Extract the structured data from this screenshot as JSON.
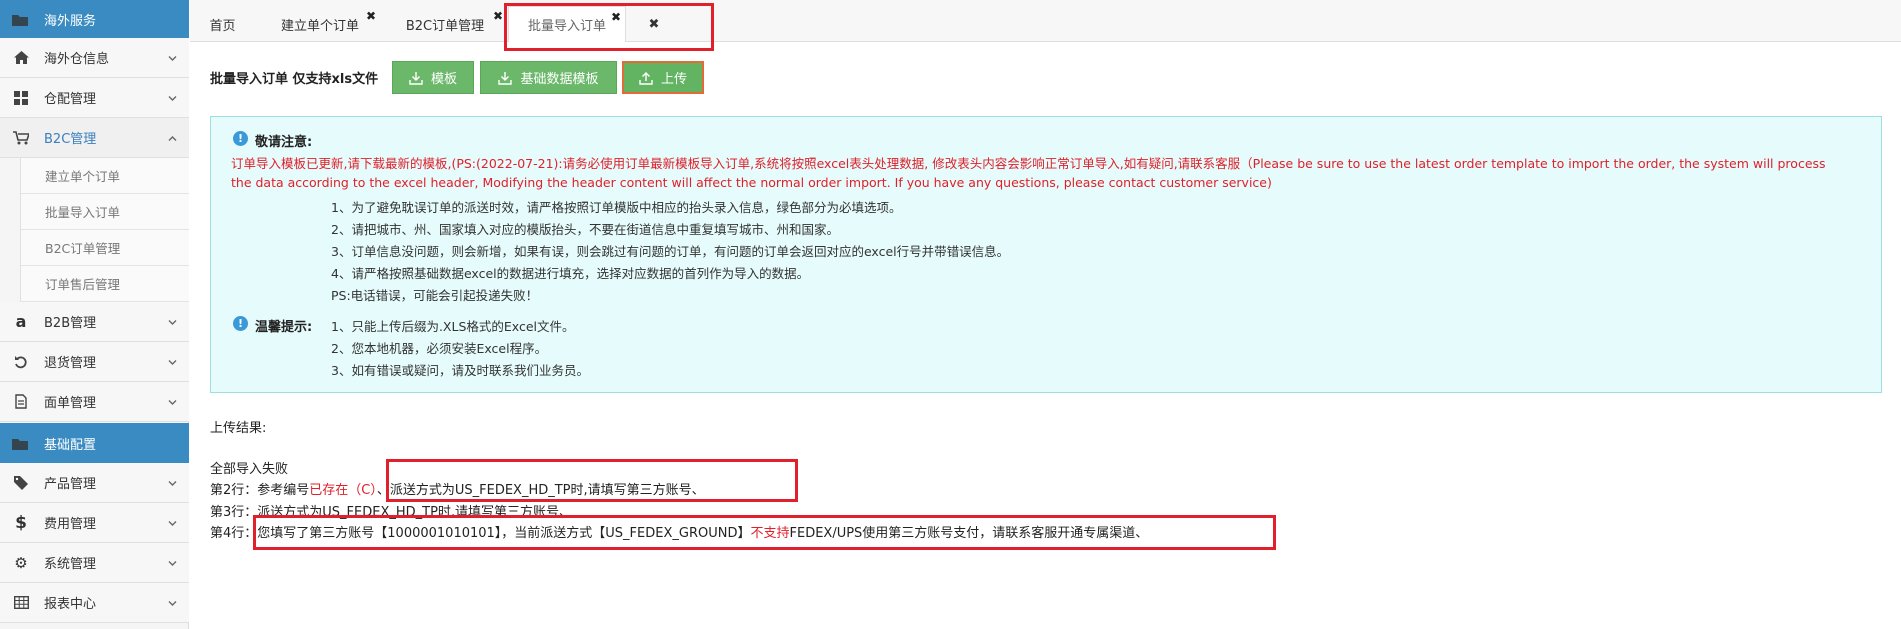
{
  "sidebar": {
    "section1": "海外服务",
    "items_top": [
      {
        "label": "海外仓信息",
        "icon": "home-icon"
      },
      {
        "label": "仓配管理",
        "icon": "grid-icon"
      },
      {
        "label": "B2C管理",
        "icon": "cart-icon",
        "active": true
      }
    ],
    "sub_items": [
      "建立单个订单",
      "批量导入订单",
      "B2C订单管理",
      "订单售后管理"
    ],
    "items_mid": [
      {
        "label": "B2B管理",
        "icon": "amazon-icon"
      },
      {
        "label": "退货管理",
        "icon": "undo-icon"
      },
      {
        "label": "面单管理",
        "icon": "document-icon"
      }
    ],
    "section2": "基础配置",
    "items_bottom": [
      {
        "label": "产品管理",
        "icon": "tag-icon"
      },
      {
        "label": "费用管理",
        "icon": "dollar-icon"
      },
      {
        "label": "系统管理",
        "icon": "gear-icon"
      },
      {
        "label": "报表中心",
        "icon": "table-icon"
      }
    ]
  },
  "tabs": [
    {
      "label": "首页"
    },
    {
      "label": "建立单个订单"
    },
    {
      "label": "B2C订单管理"
    },
    {
      "label": "批量导入订单"
    }
  ],
  "toolbar": {
    "label": "批量导入订单 仅支持xls文件",
    "template_label": "模板",
    "base_template_label": "基础数据模板",
    "upload_label": "上传"
  },
  "notice": {
    "title": "敬请注意:",
    "red_line1": "订单导入模板已更新,请下载最新的模板,(PS:(2022-07-21):请务必使用订单最新模板导入订单,系统将按照excel表头处理数据, 修改表头内容会影响正常订单导入,如有疑问,请联系客服（Please be sure to use the latest order template to import the order, the system will process",
    "red_line2": "the data according to the excel header, Modifying the header content will affect the normal order import. If you have any questions, please contact customer service)",
    "items": [
      "1、为了避免耽误订单的派送时效，请严格按照订单模版中相应的抬头录入信息，绿色部分为必填选项。",
      "2、请把城市、州、国家填入对应的模版抬头，不要在街道信息中重复填写城市、州和国家。",
      "3、订单信息没问题，则会新增，如果有误，则会跳过有问题的订单，有问题的订单会返回对应的excel行号并带错误信息。",
      "4、请严格按照基础数据excel的数据进行填充，选择对应数据的首列作为导入的数据。",
      "PS:电话错误，可能会引起投递失败！"
    ],
    "tip_title": "温馨提示:",
    "tips": [
      "1、只能上传后缀为.XLS格式的Excel文件。",
      "2、您本地机器，必须安装Excel程序。",
      "3、如有错误或疑问，请及时联系我们业务员。"
    ]
  },
  "result": {
    "heading": "上传结果:",
    "summary": "全部导入失败",
    "row2_prefix": "第2行：参考编号",
    "row2_red": "已存在（C）",
    "row2_rest": "、派送方式为US_FEDEX_HD_TP时,请填写第三方账号、",
    "row3": "第3行：派送方式为US_FEDEX_HD_TP时,请填写第三方账号、",
    "row4_prefix": "第4行：您填写了第三方账号【1000001010101】，当前派送方式【US_FEDEX_GROUND】",
    "row4_red": "不支持",
    "row4_rest": "FEDEX/UPS使用第三方账号支付，请联系客服开通专属渠道、"
  },
  "colors": {
    "accent": "#3a8bc2",
    "button": "#6bb86b",
    "notice_bg": "#e6fbfb",
    "error": "#e0202a"
  }
}
